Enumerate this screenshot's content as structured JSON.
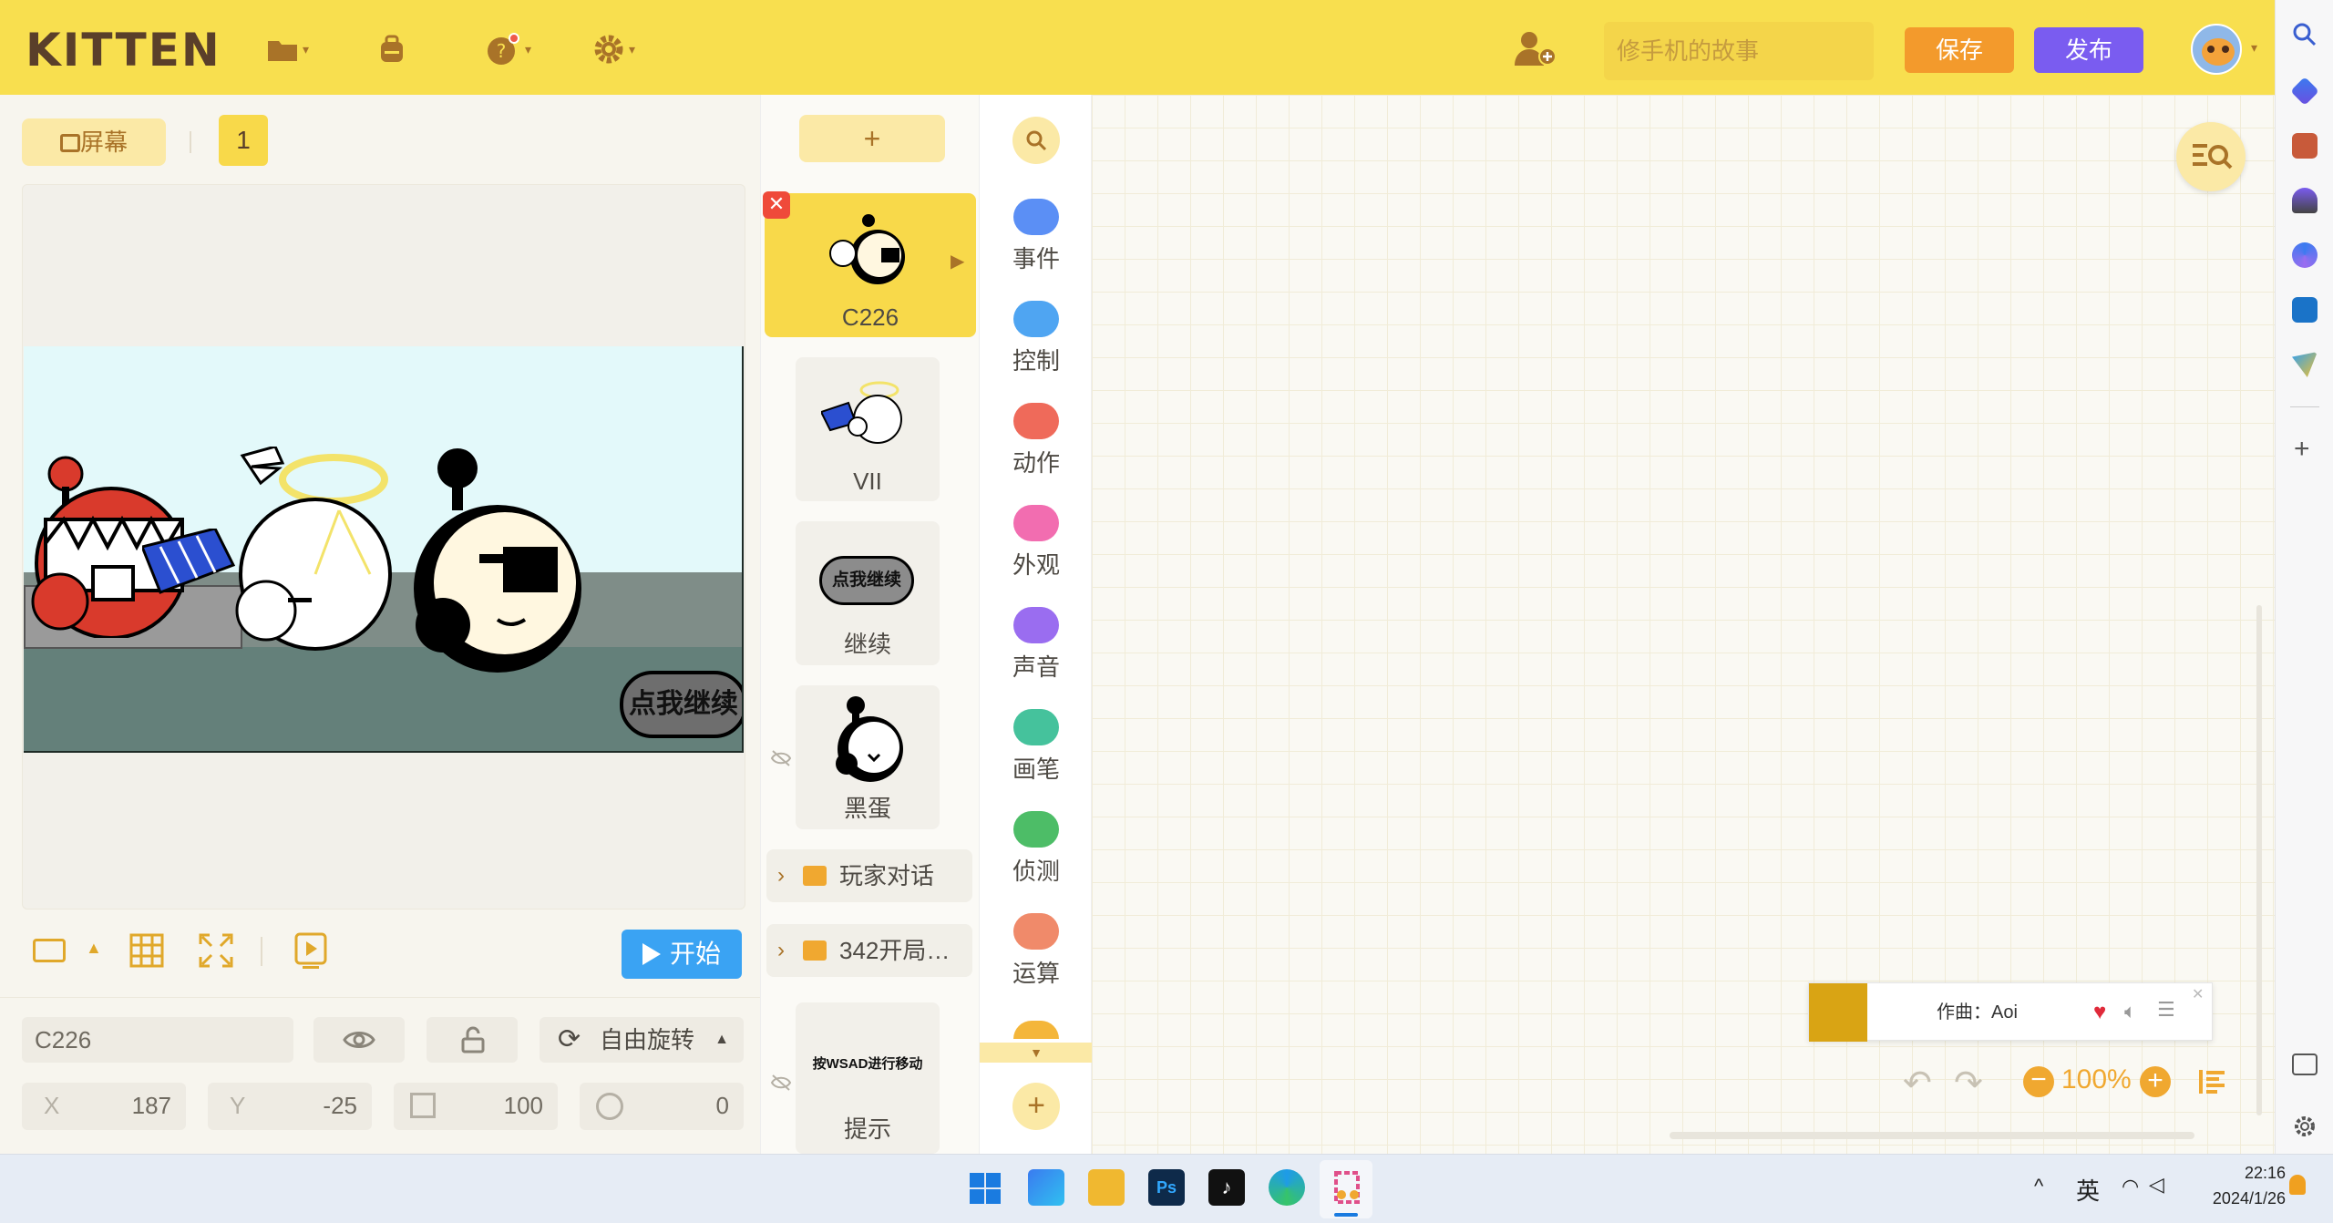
{
  "header": {
    "logo": "KITTEN",
    "project_title_placeholder": "修手机的故事",
    "save_label": "保存",
    "publish_label": "发布"
  },
  "stage": {
    "screen_label": "屏幕",
    "screen_number": "1",
    "start_label": "开始",
    "stage_button_text": "点我继续",
    "sprite_name": "C226",
    "rotation_label": "自由旋转",
    "x_label": "X",
    "x_value": "187",
    "y_label": "Y",
    "y_value": "-25",
    "size_value": "100",
    "direction_value": "0"
  },
  "sprites": {
    "add_label": "+",
    "items": [
      {
        "name": "C226",
        "selected": true
      },
      {
        "name": "VII"
      },
      {
        "name": "继续",
        "thumb_text": "点我继续"
      },
      {
        "name": "黑蛋"
      }
    ],
    "folders": [
      "玩家对话",
      "342开局…"
    ],
    "hint": {
      "name": "提示",
      "thumb_text": "按WSAD进行移动"
    }
  },
  "categories": [
    {
      "label": "事件",
      "color": "#5b8ff5"
    },
    {
      "label": "控制",
      "color": "#4fa5f2"
    },
    {
      "label": "动作",
      "color": "#ef6a5a"
    },
    {
      "label": "外观",
      "color": "#f26db0"
    },
    {
      "label": "声音",
      "color": "#9a6df0"
    },
    {
      "label": "画笔",
      "color": "#45c29c"
    },
    {
      "label": "侦测",
      "color": "#4dbd67"
    },
    {
      "label": "运算",
      "color": "#f08a6a"
    }
  ],
  "workspace": {
    "zoom_label": "100%"
  },
  "music": {
    "composer": "作曲：Aoi"
  },
  "taskbar": {
    "ime": "英",
    "time": "22:16",
    "date": "2024/1/26"
  }
}
